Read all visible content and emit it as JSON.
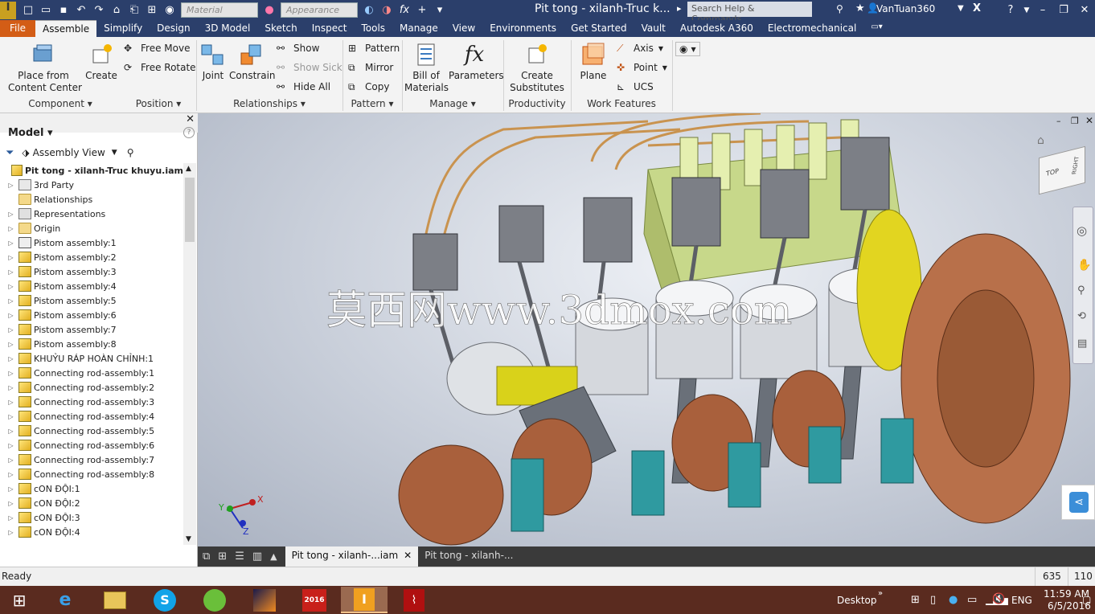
{
  "app": {
    "title": "Pit tong - xilanh-Truc k...",
    "user": "VanTuan360"
  },
  "quick_access": {
    "material": "Material",
    "appearance": "Appearance",
    "fx": "fx"
  },
  "search": {
    "placeholder": "Search Help & Commands..."
  },
  "menu_tabs": [
    {
      "label": "File"
    },
    {
      "label": "Assemble"
    },
    {
      "label": "Simplify"
    },
    {
      "label": "Design"
    },
    {
      "label": "3D Model"
    },
    {
      "label": "Sketch"
    },
    {
      "label": "Inspect"
    },
    {
      "label": "Tools"
    },
    {
      "label": "Manage"
    },
    {
      "label": "View"
    },
    {
      "label": "Environments"
    },
    {
      "label": "Get Started"
    },
    {
      "label": "Vault"
    },
    {
      "label": "Autodesk A360"
    },
    {
      "label": "Electromechanical"
    }
  ],
  "ribbon": {
    "place": "Place from\nContent Center",
    "create": "Create",
    "free_move": "Free Move",
    "free_rotate": "Free Rotate",
    "joint": "Joint",
    "constrain": "Constrain",
    "show": "Show",
    "show_sick": "Show Sick",
    "hide_all": "Hide All",
    "pattern": "Pattern",
    "mirror": "Mirror",
    "copy": "Copy",
    "bom": "Bill of\nMaterials",
    "parameters": "Parameters",
    "create_substitutes": "Create\nSubstitutes",
    "plane": "Plane",
    "axis": "Axis",
    "point": "Point",
    "ucs": "UCS",
    "panels": {
      "component": "Component",
      "position": "Position",
      "relationships": "Relationships",
      "pattern": "Pattern",
      "manage": "Manage",
      "productivity": "Productivity",
      "work_features": "Work Features"
    }
  },
  "browser": {
    "title": "Model",
    "view": "Assembly View",
    "root": "Pit tong - xilanh-Truc khuyu.iam",
    "items": [
      {
        "label": "3rd Party"
      },
      {
        "label": "Relationships"
      },
      {
        "label": "Representations"
      },
      {
        "label": "Origin"
      },
      {
        "label": "Pistom assembly:1"
      },
      {
        "label": "Pistom assembly:2"
      },
      {
        "label": "Pistom assembly:3"
      },
      {
        "label": "Pistom assembly:4"
      },
      {
        "label": "Pistom assembly:5"
      },
      {
        "label": "Pistom assembly:6"
      },
      {
        "label": "Pistom assembly:7"
      },
      {
        "label": "Pistom assembly:8"
      },
      {
        "label": "KHUỶU RÁP HOÀN CHỈNH:1"
      },
      {
        "label": "Connecting rod-assembly:1"
      },
      {
        "label": "Connecting rod-assembly:2"
      },
      {
        "label": "Connecting rod-assembly:3"
      },
      {
        "label": "Connecting rod-assembly:4"
      },
      {
        "label": "Connecting rod-assembly:5"
      },
      {
        "label": "Connecting rod-assembly:6"
      },
      {
        "label": "Connecting rod-assembly:7"
      },
      {
        "label": "Connecting rod-assembly:8"
      },
      {
        "label": "cON ĐỘI:1"
      },
      {
        "label": "cON ĐỘI:2"
      },
      {
        "label": "cON ĐỘI:3"
      },
      {
        "label": "cON ĐỘI:4"
      }
    ]
  },
  "viewport": {
    "watermark": "莫西网www.3dmox.com",
    "viewcube_top": "TOP",
    "viewcube_right": "RIGHT",
    "axis_x": "X",
    "axis_y": "Y",
    "axis_z": "Z"
  },
  "doc_tabs": [
    {
      "label": "Pit tong - xilanh-...iam"
    },
    {
      "label": "Pit tong - xilanh-..."
    }
  ],
  "status": {
    "text": "Ready",
    "x": "635",
    "y": "110"
  },
  "taskbar": {
    "desktop": "Desktop",
    "lang": "ENG",
    "time": "11:59 AM",
    "date": "6/5/2016",
    "sw": "2016"
  }
}
